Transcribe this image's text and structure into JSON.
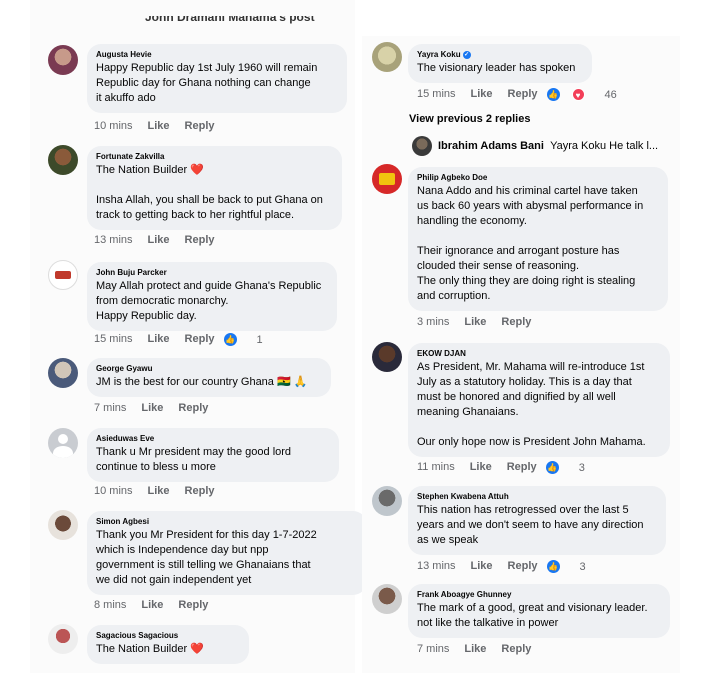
{
  "post_header": "John Dramani Mahama's post",
  "left_comments": [
    {
      "name": "Augusta Hevie",
      "lines": [
        "Happy  Republic  day 1st July  1960 will remain",
        "Republic  day for Ghana  nothing  can change",
        "it akuffo ado"
      ],
      "time": "10 mins",
      "like": "Like",
      "reply": "Reply"
    },
    {
      "name": "Fortunate Zakvilla",
      "lines": [
        "The Nation Builder ❤️",
        "",
        "Insha Allah, you shall be back to put Ghana on",
        "track to getting back to her rightful place."
      ],
      "time": "13 mins",
      "like": "Like",
      "reply": "Reply"
    },
    {
      "name": "John Buju Parcker",
      "lines": [
        "May Allah protect and guide Ghana's Republic",
        "from democratic monarchy.",
        "Happy Republic day."
      ],
      "time": "15 mins",
      "like": "Like",
      "reply": "Reply",
      "reaction_count": "1"
    },
    {
      "name": "George Gyawu",
      "lines": [
        "JM is the best for our country Ghana 🇬🇭 🙏"
      ],
      "time": "7 mins",
      "like": "Like",
      "reply": "Reply"
    },
    {
      "name": "Asieduwas Eve",
      "lines": [
        "Thank u Mr president may the good lord",
        "continue to bless u more"
      ],
      "time": "10 mins",
      "like": "Like",
      "reply": "Reply"
    },
    {
      "name": "Simon Agbesi",
      "lines": [
        "Thank you Mr  President for this day 1-7-2022",
        "which is Independence day but npp",
        "government is still telling we Ghanaians that",
        "we did not gain independent yet"
      ],
      "time": "8 mins",
      "like": "Like",
      "reply": "Reply"
    },
    {
      "name": "Sagacious Sagacious",
      "lines": [
        "The Nation Builder ❤️"
      ]
    }
  ],
  "right_comments": [
    {
      "name": "Yayra Koku",
      "lines": [
        "The visionary leader has spoken"
      ],
      "time": "15 mins",
      "like": "Like",
      "reply": "Reply",
      "reaction_count": "46"
    },
    {
      "name": "Philip Agbeko Doe",
      "lines": [
        "Nana Addo and his criminal cartel have taken",
        "us back 60 years with abysmal performance in",
        "handling the economy.",
        "",
        "Their ignorance and arrogant posture has",
        "clouded their sense of reasoning.",
        "The only thing they are doing right is stealing",
        "and corruption."
      ],
      "time": "3 mins",
      "like": "Like",
      "reply": "Reply"
    },
    {
      "name": "EKOW DJAN",
      "lines": [
        "As President, Mr. Mahama will re-introduce 1st",
        "July as a statutory holiday. This is a day that",
        "must be honored and dignified by all well",
        "meaning Ghanaians.",
        "",
        "Our only hope now is President John Mahama."
      ],
      "time": "11 mins",
      "like": "Like",
      "reply": "Reply",
      "reaction_count": "3"
    },
    {
      "name": "Stephen Kwabena Attuh",
      "lines": [
        "This nation has retrogressed over the last 5",
        "years and we don't seem to have any direction",
        "as we speak"
      ],
      "time": "13 mins",
      "like": "Like",
      "reply": "Reply",
      "reaction_count": "3"
    },
    {
      "name": "Frank Aboagye Ghunney",
      "lines": [
        "The mark of a good, great and visionary leader.",
        "not like the talkative in power"
      ],
      "time": "7 mins",
      "like": "Like",
      "reply": "Reply"
    }
  ],
  "view_previous": "View previous 2 replies",
  "reply_preview": {
    "name": "Ibrahim Adams Bani",
    "text": "Yayra Koku He talk l..."
  },
  "icons": {
    "like": "thumbs-up-icon",
    "love": "heart-icon",
    "verified": "verified-badge-icon"
  },
  "colors": {
    "bubble": "#eef0f3",
    "like_blue": "#1877f2",
    "love_red": "#f33e58",
    "meta": "#65676b"
  }
}
